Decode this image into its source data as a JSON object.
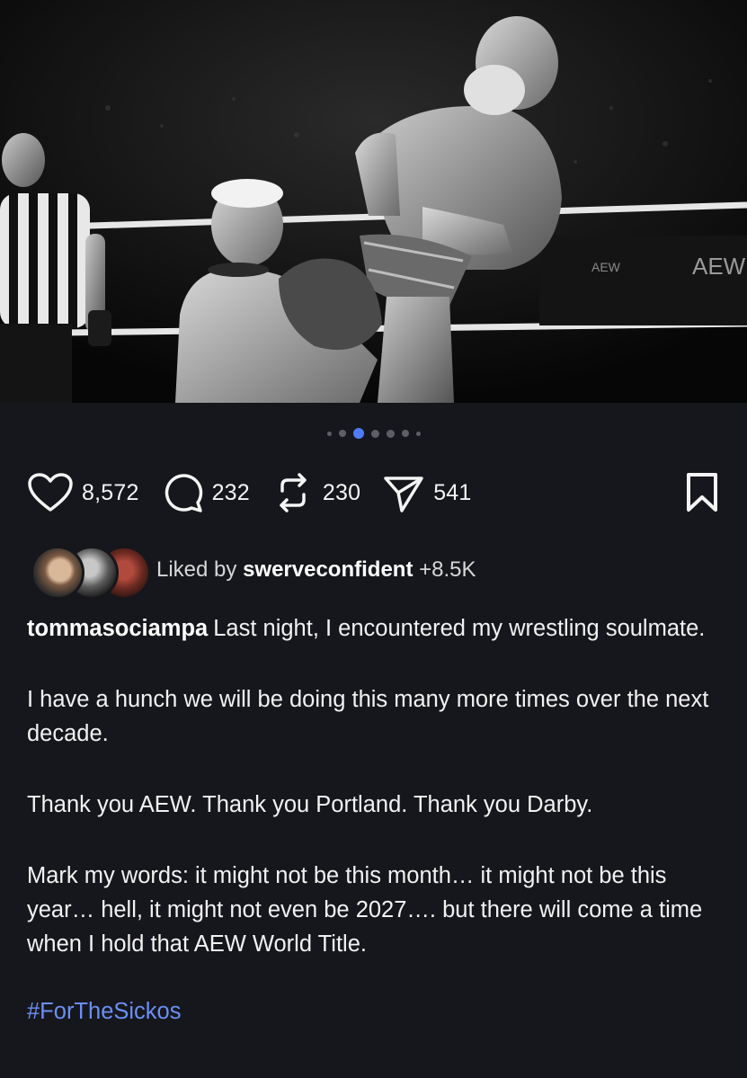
{
  "post": {
    "image_alt": "Black and white photo of two wrestlers in a ring with a referee",
    "carousel": {
      "count": 7,
      "active_index": 2
    }
  },
  "actions": {
    "likes": "8,572",
    "comments": "232",
    "reposts": "230",
    "shares": "541"
  },
  "liked_by": {
    "prefix": "Liked by",
    "user": "swerveconfident",
    "suffix": "+8.5K"
  },
  "caption": {
    "username": "tommasociampa",
    "paragraphs": [
      "Last night, I encountered my wrestling soulmate.",
      "I have a hunch we will be doing this many more times over the next decade.",
      "Thank you AEW. Thank you Portland. Thank you Darby.",
      "Mark my words: it might not be this month… it might not be this year… hell, it might not even be 2027…. but there will come a time when I hold that AEW World Title."
    ],
    "hashtag": "#ForTheSickos"
  },
  "watermarks": {
    "left": "AEW",
    "right": "AEW"
  },
  "icons": [
    "heart-icon",
    "comment-icon",
    "repost-icon",
    "share-icon",
    "bookmark-icon"
  ],
  "colors": {
    "background": "#16171c",
    "accent_dot": "#4f7cf6",
    "hashtag": "#6b8ff5"
  }
}
